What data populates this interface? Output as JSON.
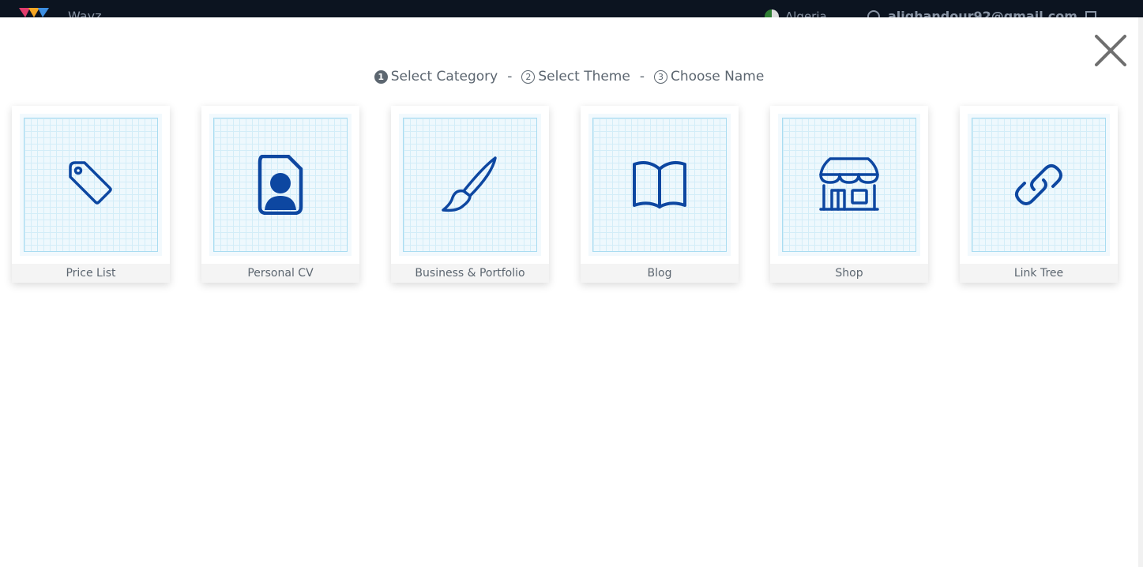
{
  "app": {
    "brand": "Wayz",
    "country": "Algeria",
    "user_email": "alighandour92@gmail.com"
  },
  "steps": [
    {
      "number": "1",
      "label": "Select Category"
    },
    {
      "number": "2",
      "label": "Select Theme"
    },
    {
      "number": "3",
      "label": "Choose Name"
    }
  ],
  "step_separator": "-",
  "categories": [
    {
      "label": "Price List",
      "icon": "price-tag-icon"
    },
    {
      "label": "Personal CV",
      "icon": "cv-document-icon"
    },
    {
      "label": "Business & Portfolio",
      "icon": "paintbrush-icon"
    },
    {
      "label": "Blog",
      "icon": "open-book-icon"
    },
    {
      "label": "Shop",
      "icon": "storefront-icon"
    },
    {
      "label": "Link Tree",
      "icon": "link-icon"
    }
  ],
  "colors": {
    "icon": "#0d47a1",
    "text": "#5c6670",
    "topbar": "#0c1420"
  }
}
